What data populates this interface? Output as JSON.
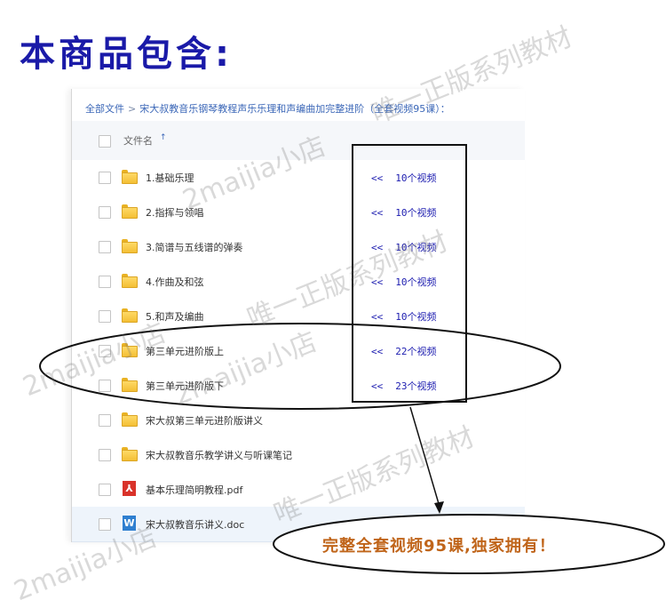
{
  "page_heading": "本商品包含:",
  "breadcrumb": {
    "root": "全部文件",
    "separator": ">",
    "current": "宋大叔教音乐钢琴教程声乐乐理和声编曲加完整进阶（全套视频95课）："
  },
  "table_header": {
    "name_label": "文件名",
    "sort_indicator": "↑"
  },
  "files": [
    {
      "type": "folder",
      "name": "1.基础乐理",
      "count": "10个视频"
    },
    {
      "type": "folder",
      "name": "2.指挥与领唱",
      "count": "10个视频"
    },
    {
      "type": "folder",
      "name": "3.简谱与五线谱的弹奏",
      "count": "10个视频"
    },
    {
      "type": "folder",
      "name": "4.作曲及和弦",
      "count": "10个视频"
    },
    {
      "type": "folder",
      "name": "5.和声及编曲",
      "count": "10个视频"
    },
    {
      "type": "folder",
      "name": "第三单元进阶版上",
      "count": "22个视频"
    },
    {
      "type": "folder",
      "name": "第三单元进阶版下",
      "count": "23个视频"
    },
    {
      "type": "folder",
      "name": "宋大叔第三单元进阶版讲义",
      "count": ""
    },
    {
      "type": "folder",
      "name": "宋大叔教音乐教学讲义与听课笔记",
      "count": ""
    },
    {
      "type": "pdf",
      "name": "基本乐理简明教程.pdf",
      "count": "",
      "icon_glyph": "⅄"
    },
    {
      "type": "doc",
      "name": "宋大叔教音乐讲义.doc",
      "count": "",
      "icon_glyph": "W"
    }
  ],
  "count_arrows": "<<",
  "callout": "完整全套视频95课,独家拥有！",
  "watermarks": {
    "shop": "2maijia小店",
    "genuine": "唯一正版系列教材"
  },
  "colors": {
    "heading": "#1a1aa8",
    "link": "#3a66b7",
    "count_text": "#1d1db0",
    "callout_text": "#c0651a",
    "folder": "#f4bf35",
    "pdf": "#d9322a",
    "doc": "#2f7fd0"
  }
}
